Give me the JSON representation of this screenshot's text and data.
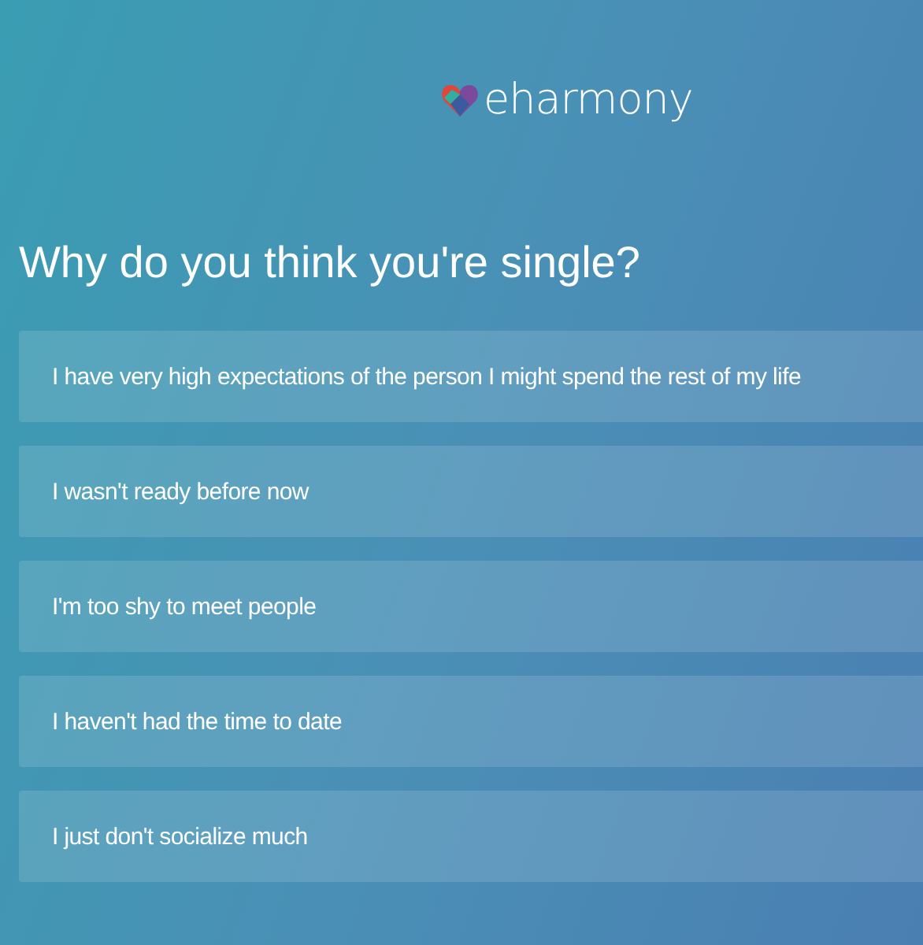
{
  "logo": {
    "text": "eharmony"
  },
  "question": "Why do you think you're single?",
  "options": [
    {
      "label": "I have very high expectations of the person I might spend the rest of my life"
    },
    {
      "label": "I wasn't ready before now"
    },
    {
      "label": "I'm too shy to meet people"
    },
    {
      "label": "I haven't had the time to date"
    },
    {
      "label": "I just don't socialize much"
    }
  ]
}
